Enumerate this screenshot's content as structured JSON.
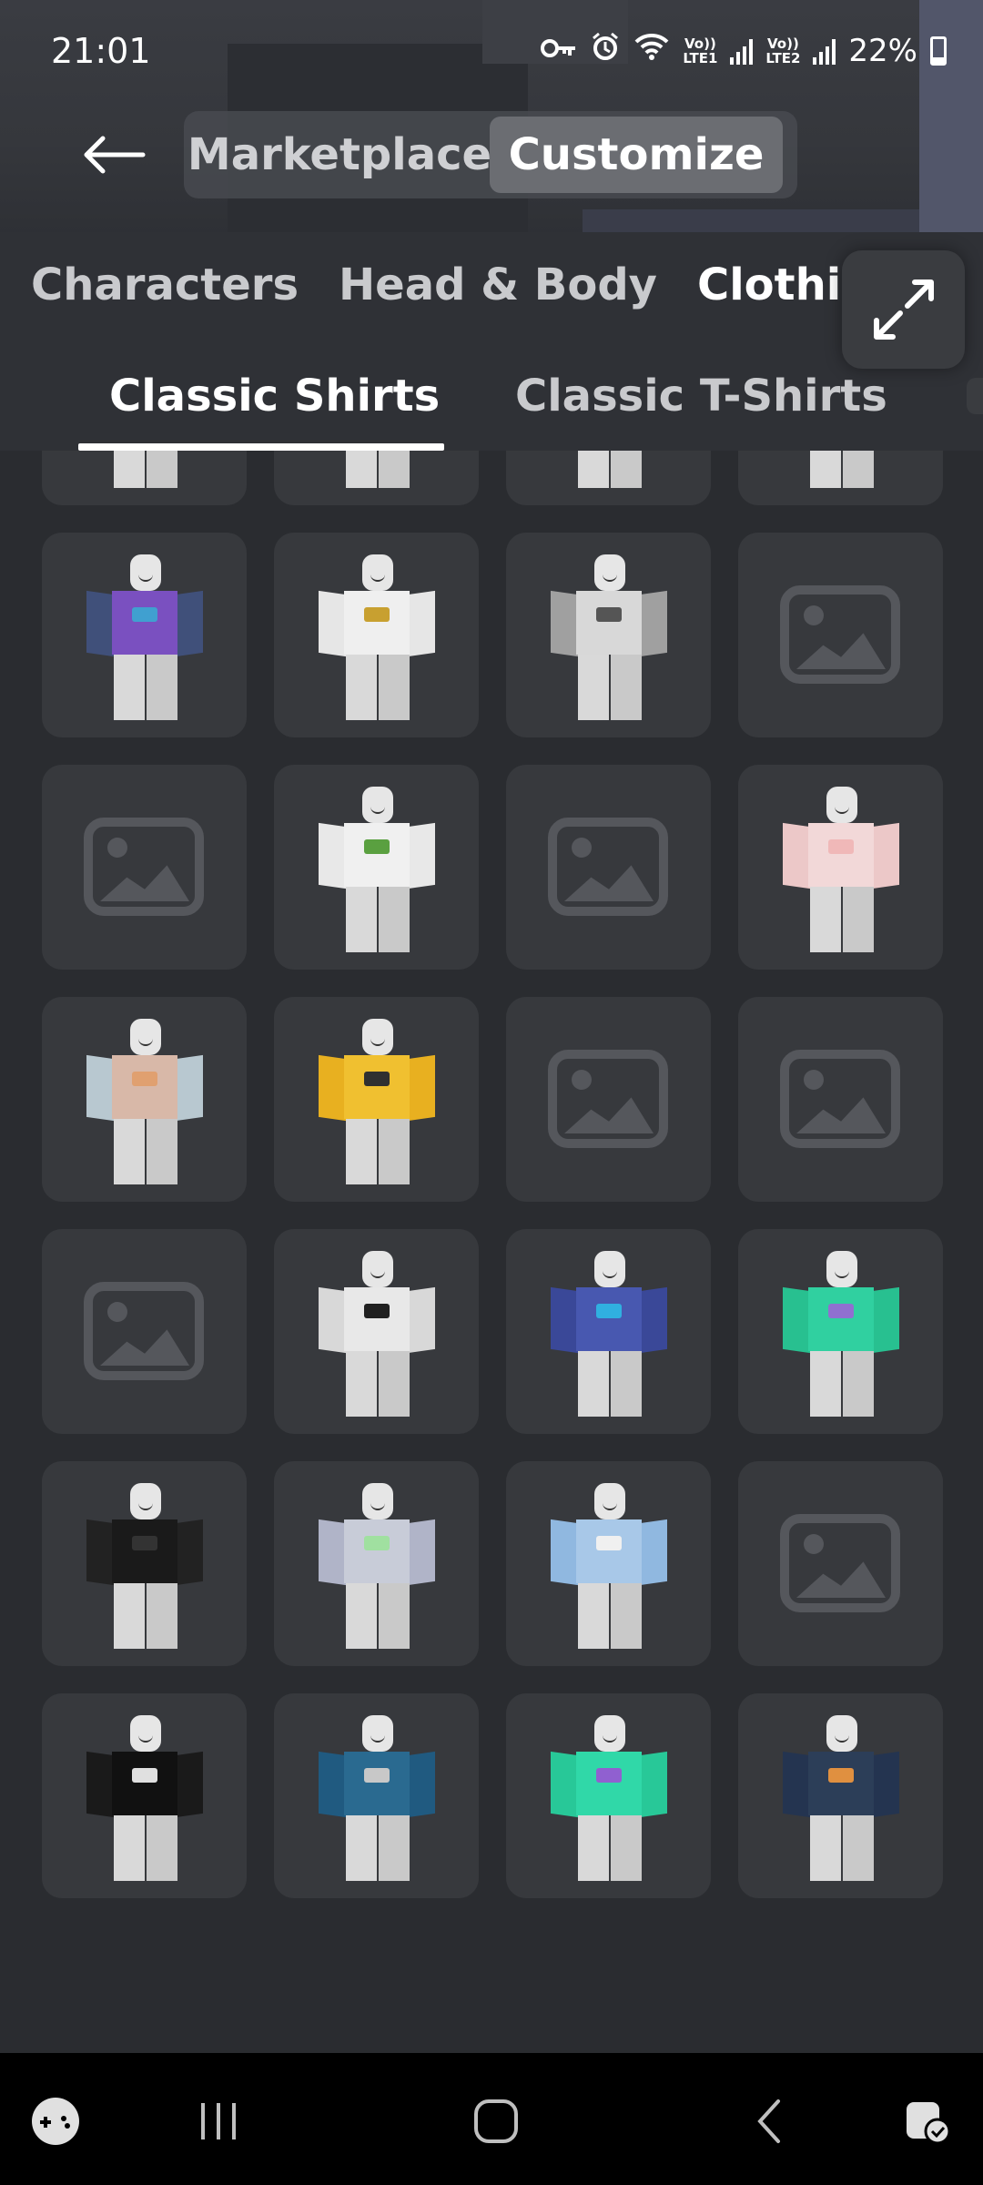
{
  "status_bar": {
    "time": "21:01",
    "volte1_top": "Vo))",
    "volte1_bottom": "LTE1",
    "volte2_top": "Vo))",
    "volte2_bottom": "LTE2",
    "battery": "22%"
  },
  "header": {
    "back_icon": "arrow-left-icon",
    "segments": [
      {
        "label": "Marketplace",
        "active": false
      },
      {
        "label": "Customize",
        "active": true
      }
    ]
  },
  "categories": [
    {
      "label": "Characters",
      "active": false
    },
    {
      "label": "Head & Body",
      "active": false
    },
    {
      "label": "Clothi",
      "active": true
    }
  ],
  "expand_icon": "expand-arrows-icon",
  "subcategories": [
    {
      "label": "Classic Shirts",
      "active": true
    },
    {
      "label": "Classic T-Shirts",
      "active": false
    }
  ],
  "items": [
    {
      "type": "avatar",
      "shirt": "#4a4c5c",
      "sleeve": "#3a3c50",
      "deco": "#7a8ab0"
    },
    {
      "type": "avatar",
      "shirt": "#6aa23a",
      "sleeve": "#4f8a30",
      "deco": "#c2d040"
    },
    {
      "type": "avatar",
      "shirt": "#d2409a",
      "sleeve": "#c03080",
      "deco": "#f070c0"
    },
    {
      "type": "avatar",
      "shirt": "#8b44d0",
      "sleeve": "#b0e070",
      "deco": "#60d0c0"
    },
    {
      "type": "avatar",
      "shirt": "#7a50c0",
      "sleeve": "#40507a",
      "deco": "#40a0d0"
    },
    {
      "type": "avatar",
      "shirt": "#efefef",
      "sleeve": "#e6e6e6",
      "deco": "#c8a030"
    },
    {
      "type": "avatar",
      "shirt": "#d8d8d8",
      "sleeve": "#a0a0a0",
      "deco": "#555555"
    },
    {
      "type": "placeholder"
    },
    {
      "type": "placeholder"
    },
    {
      "type": "avatar",
      "shirt": "#f0f0f0",
      "sleeve": "#e8e8e8",
      "deco": "#5aa040"
    },
    {
      "type": "placeholder"
    },
    {
      "type": "avatar",
      "shirt": "#f2d8d8",
      "sleeve": "#ecc8c8",
      "deco": "#f0b8b8"
    },
    {
      "type": "avatar",
      "shirt": "#d8b8a8",
      "sleeve": "#b8c8d0",
      "deco": "#e0a070"
    },
    {
      "type": "avatar",
      "shirt": "#f0c030",
      "sleeve": "#e8b020",
      "deco": "#303030"
    },
    {
      "type": "placeholder"
    },
    {
      "type": "placeholder"
    },
    {
      "type": "placeholder"
    },
    {
      "type": "avatar",
      "shirt": "#e8e8e8",
      "sleeve": "#d8d8d8",
      "deco": "#202020"
    },
    {
      "type": "avatar",
      "shirt": "#4858b0",
      "sleeve": "#3a4898",
      "deco": "#30b0e0"
    },
    {
      "type": "avatar",
      "shirt": "#30d0a0",
      "sleeve": "#28c090",
      "deco": "#9070d0"
    },
    {
      "type": "avatar",
      "shirt": "#1a1a1a",
      "sleeve": "#222222",
      "deco": "#333333"
    },
    {
      "type": "avatar",
      "shirt": "#c8ccd8",
      "sleeve": "#b0b4c8",
      "deco": "#a0e0a0"
    },
    {
      "type": "avatar",
      "shirt": "#a8c8e8",
      "sleeve": "#90b8e0",
      "deco": "#f0f0f0"
    },
    {
      "type": "placeholder"
    },
    {
      "type": "avatar",
      "shirt": "#111111",
      "sleeve": "#1a1a1a",
      "deco": "#e0e0e0"
    },
    {
      "type": "avatar",
      "shirt": "#2a6a90",
      "sleeve": "#205a80",
      "deco": "#c8c8c8"
    },
    {
      "type": "avatar",
      "shirt": "#30d8a8",
      "sleeve": "#28c898",
      "deco": "#9060d0"
    },
    {
      "type": "avatar",
      "shirt": "#2c3e58",
      "sleeve": "#243450",
      "deco": "#e09040"
    }
  ],
  "nav_icons": [
    "game-controller-icon",
    "recent-apps-icon",
    "home-icon",
    "back-icon",
    "assistant-icon"
  ]
}
